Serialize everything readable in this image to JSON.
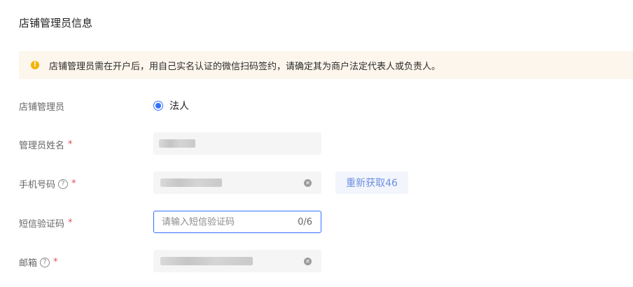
{
  "section": {
    "title": "店铺管理员信息"
  },
  "alert": {
    "icon": "warning-icon",
    "text": "店铺管理员需在开户后，用自己实名认证的微信扫码签约，请确定其为商户法定代表人或负责人。",
    "color": "#fdf6ec"
  },
  "form": {
    "admin": {
      "label": "店铺管理员",
      "option": "法人",
      "selected": true
    },
    "name": {
      "label": "管理员姓名",
      "required": "*"
    },
    "phone": {
      "label": "手机号码",
      "help": "?",
      "required": "*",
      "resend": "重新获取46"
    },
    "sms": {
      "label": "短信验证码",
      "required": "*",
      "placeholder": "请输入短信验证码",
      "counter": "0/6"
    },
    "email": {
      "label": "邮箱",
      "help": "?",
      "required": "*"
    }
  },
  "colors": {
    "accent": "#3370ff",
    "required": "#e34d59",
    "warning": "#f5b300"
  }
}
